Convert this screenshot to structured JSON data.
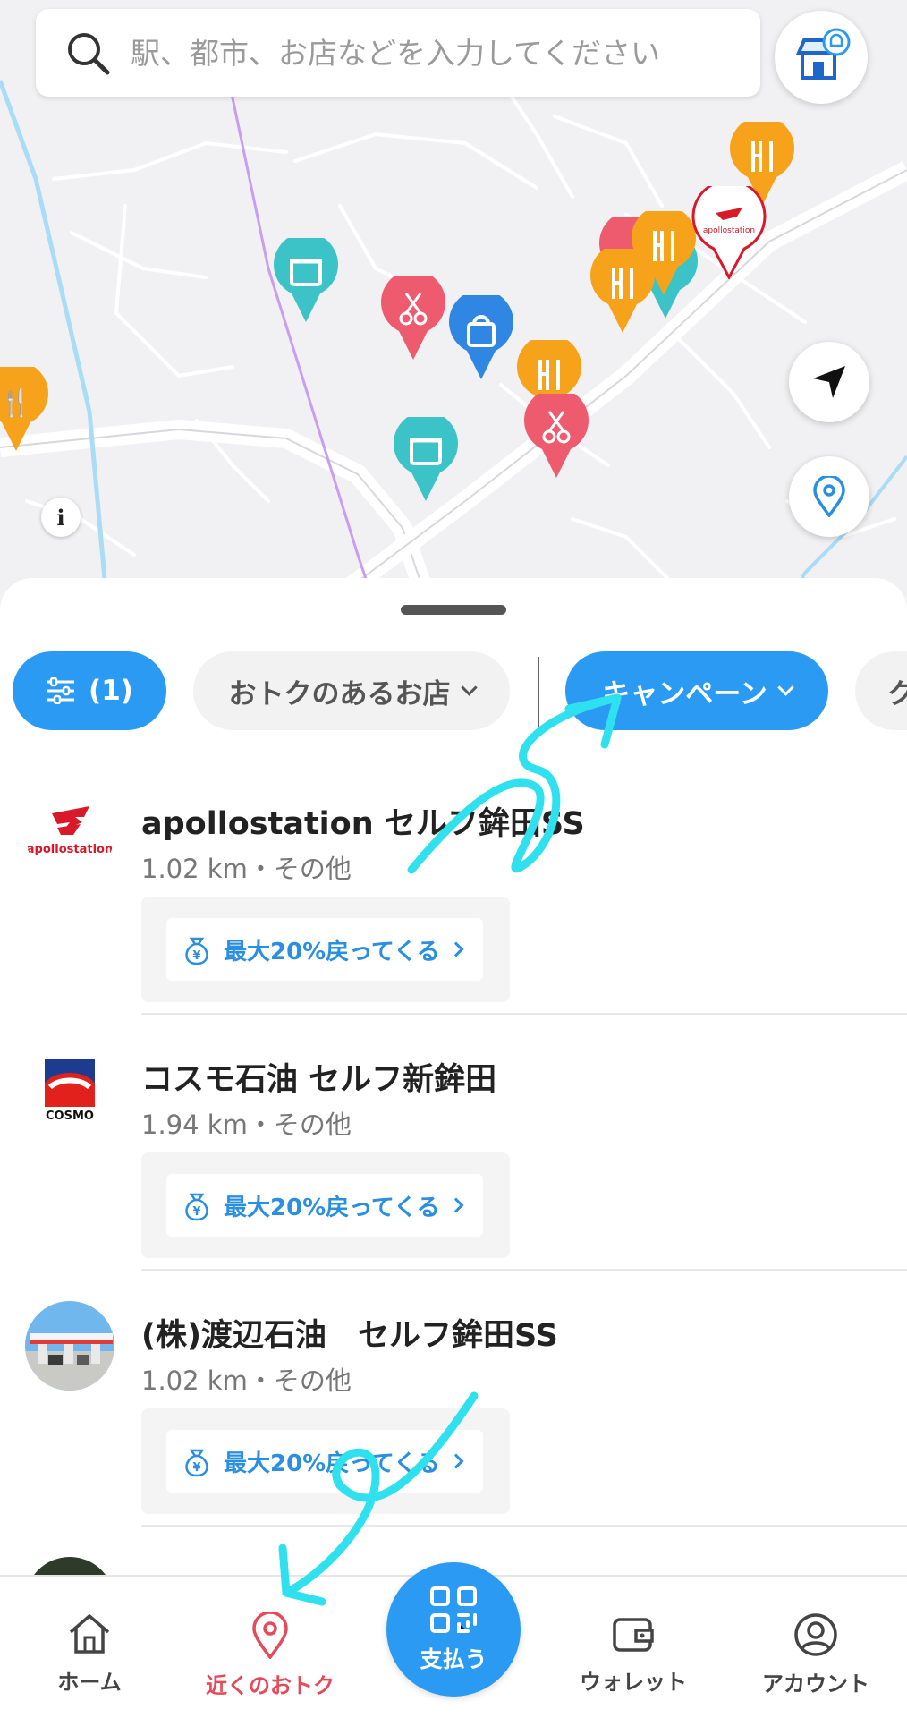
{
  "search": {
    "placeholder": "駅、都市、お店などを入力してください"
  },
  "map": {
    "info_label": "i"
  },
  "filters": {
    "filter_count": "(1)",
    "chips": [
      {
        "label": "おトクのあるお店"
      },
      {
        "label": "キャンペーン"
      },
      {
        "label": "ク"
      }
    ]
  },
  "stores": [
    {
      "name": "apollostation セルフ鉾田SS",
      "distance": "1.02 km",
      "category": "その他",
      "offer": "最大20%戻ってくる",
      "logo": "apollostation-logo"
    },
    {
      "name": "コスモ石油 セルフ新鉾田",
      "distance": "1.94 km",
      "category": "その他",
      "offer": "最大20%戻ってくる",
      "logo": "cosmo-logo"
    },
    {
      "name": "(株)渡辺石油　セルフ鉾田SS",
      "distance": "1.02 km",
      "category": "その他",
      "offer": "最大20%戻ってくる",
      "logo": "gas-station-photo"
    }
  ],
  "meta_sep": "・",
  "logos": {
    "apollostation": "apollostation",
    "cosmo": "COSMO"
  },
  "bottom_nav": {
    "home": "ホーム",
    "nearby": "近くのおトク",
    "pay": "支払う",
    "wallet": "ウォレット",
    "account": "アカウント"
  },
  "colors": {
    "primary_blue": "#2b9af3",
    "active_red": "#e54a5a",
    "pin_orange": "#f7a21b",
    "pin_red": "#ee5a6e",
    "pin_teal": "#3cc3c8",
    "pin_blue": "#2f86e3",
    "annotation_cyan": "#2fe0ee"
  }
}
